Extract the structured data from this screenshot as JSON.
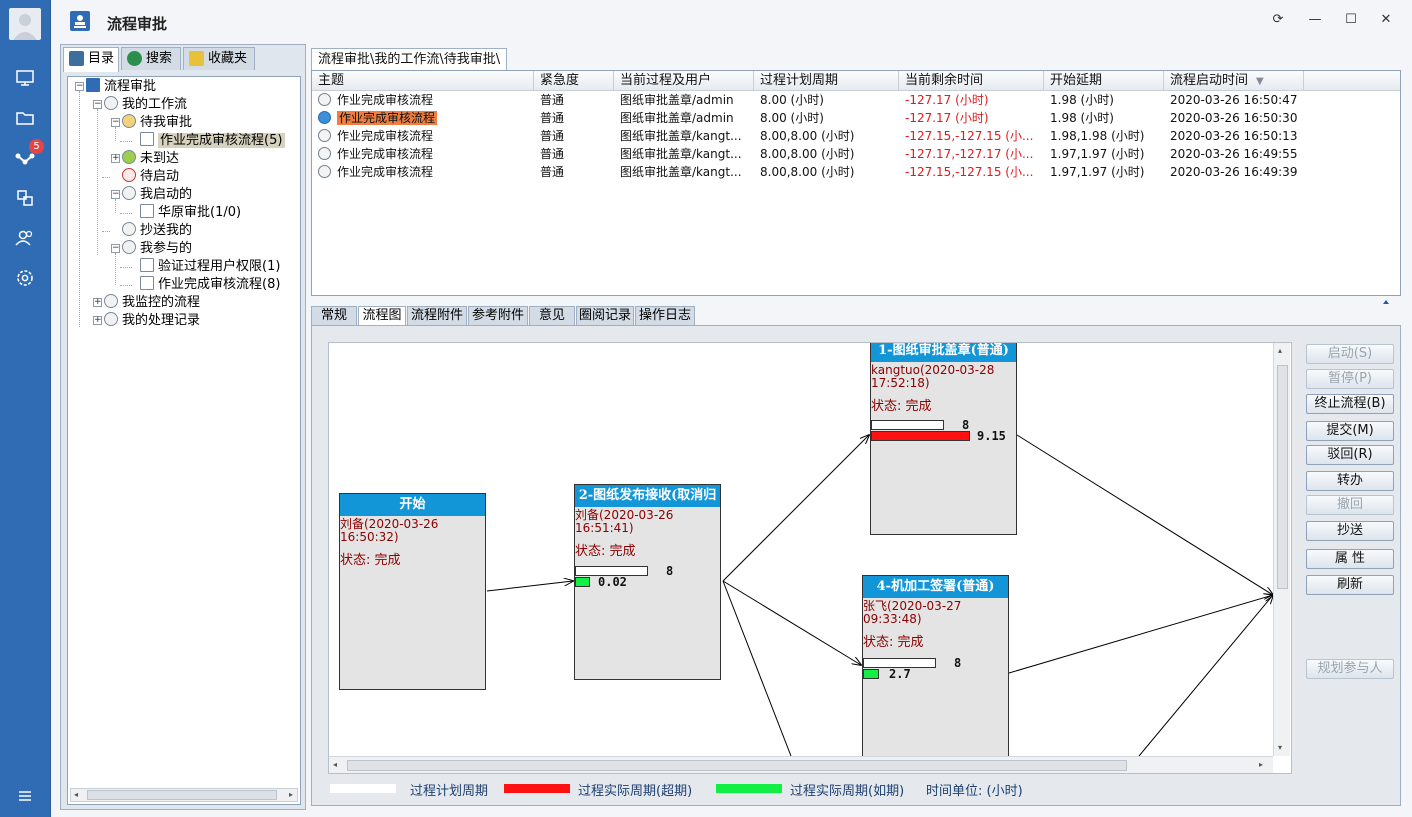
{
  "app": {
    "title": "流程审批"
  },
  "rail": {
    "notification_count": "5"
  },
  "left": {
    "tabs": [
      {
        "label": "目录"
      },
      {
        "label": "搜索"
      },
      {
        "label": "收藏夹"
      }
    ],
    "tree": {
      "root": "流程审批",
      "my_workflow": "我的工作流",
      "pending_approval": "待我审批",
      "pending_item": "作业完成审核流程",
      "pending_item_count": "(5)",
      "not_arrived": "未到达",
      "to_start": "待启动",
      "started_by_me": "我启动的",
      "started_item": "华原审批",
      "started_item_count": "(1/0)",
      "cc_me": "抄送我的",
      "participated": "我参与的",
      "participated_item1": "验证过程用户权限",
      "participated_item1_count": "(1)",
      "participated_item2": "作业完成审核流程",
      "participated_item2_count": "(8)",
      "monitored": "我监控的流程",
      "handled": "我的处理记录"
    }
  },
  "main": {
    "breadcrumb": "流程审批\\我的工作流\\待我审批\\",
    "columns": [
      "主题",
      "紧急度",
      "当前过程及用户",
      "过程计划周期",
      "当前剩余时间",
      "开始延期",
      "流程启动时间"
    ],
    "rows": [
      {
        "subject": "作业完成审核流程",
        "urgency": "普通",
        "process": "图纸审批盖章/admin",
        "plan": "8.00 (小时)",
        "remain": "-127.17 (小时)",
        "delay": "1.98 (小时)",
        "start": "2020-03-26 16:50:47"
      },
      {
        "subject": "作业完成审核流程",
        "urgency": "普通",
        "process": "图纸审批盖章/admin",
        "plan": "8.00 (小时)",
        "remain": "-127.17 (小时)",
        "delay": "1.98 (小时)",
        "start": "2020-03-26 16:50:30"
      },
      {
        "subject": "作业完成审核流程",
        "urgency": "普通",
        "process": "图纸审批盖章/kangt...",
        "plan": "8.00,8.00 (小时)",
        "remain": "-127.15,-127.15 (小...",
        "delay": "1.98,1.98 (小时)",
        "start": "2020-03-26 16:50:13"
      },
      {
        "subject": "作业完成审核流程",
        "urgency": "普通",
        "process": "图纸审批盖章/kangt...",
        "plan": "8.00,8.00 (小时)",
        "remain": "-127.17,-127.17 (小...",
        "delay": "1.97,1.97 (小时)",
        "start": "2020-03-26 16:49:55"
      },
      {
        "subject": "作业完成审核流程",
        "urgency": "普通",
        "process": "图纸审批盖章/kangt...",
        "plan": "8.00,8.00 (小时)",
        "remain": "-127.15,-127.15 (小...",
        "delay": "1.97,1.97 (小时)",
        "start": "2020-03-26 16:49:39"
      }
    ],
    "detail_tabs": [
      "常规",
      "流程图",
      "流程附件",
      "参考附件",
      "意见",
      "圈阅记录",
      "操作日志"
    ],
    "flow": {
      "start": {
        "title": "开始",
        "user": "刘备(2020-03-26",
        "time": "16:50:32)",
        "status": "状态: 完成"
      },
      "step2": {
        "title": "2-图纸发布接收(取消归",
        "user": "刘备(2020-03-26",
        "time": "16:51:41)",
        "status": "状态: 完成",
        "plan": "8",
        "actual": "0.02"
      },
      "step1": {
        "title": "1-图纸审批盖章(普通)",
        "user": "kangtuo(2020-03-28",
        "time": "17:52:18)",
        "status": "状态: 完成",
        "plan": "8",
        "actual": "9.15"
      },
      "step4": {
        "title": "4-机加工签署(普通)",
        "user": "张飞(2020-03-27",
        "time": "09:33:48)",
        "status": "状态: 完成",
        "plan": "8",
        "actual": "2.7"
      }
    },
    "legend": {
      "plan": "过程计划周期",
      "over": "过程实际周期(超期)",
      "ontime": "过程实际周期(如期)",
      "unit": "时间单位: (小时)"
    },
    "colors": {
      "plan": "#ffffff",
      "over": "#ff1111",
      "ontime": "#11ee44",
      "node_header": "#1396d8"
    },
    "actions": [
      "启动(S)",
      "暂停(P)",
      "终止流程(B)",
      "提交(M)",
      "驳回(R)",
      "转办",
      "撤回",
      "抄送",
      "属 性",
      "刷新",
      "规划参与人"
    ]
  }
}
